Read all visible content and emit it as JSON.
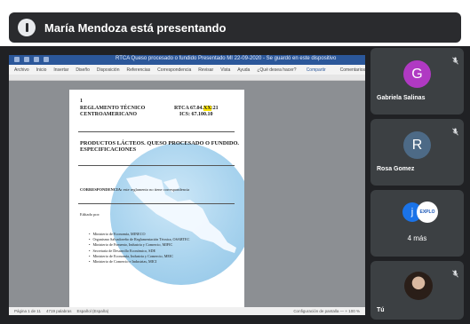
{
  "presenter_banner": {
    "text": "María Mendoza está presentando"
  },
  "shared_screen": {
    "window_title": "RTCA Queso procesado o fundido Presentado MI 22-09-2020 - Se guardó en este dispositivo",
    "menu": [
      "Archivo",
      "Inicio",
      "Insertar",
      "Diseño",
      "Disposición",
      "Referencias",
      "Correspondencia",
      "Revisar",
      "Vista",
      "Ayuda",
      "¿Qué desea hacer?"
    ],
    "menu_right": [
      "Compartir",
      "Comentarios"
    ],
    "document": {
      "heading_left_1": "REGLAMENTO TÉCNICO",
      "heading_left_2": "CENTROAMERICANO",
      "rtca_prefix": "RTCA 67.04.",
      "rtca_highlight": "XX",
      "rtca_suffix": ":21",
      "ics": "ICS: 67.100.10",
      "page_marker": "1",
      "product_title_1": "PRODUCTOS LÁCTEOS.  QUESO PROCESADO O FUNDIDO.",
      "product_title_2": "ESPECIFICACIONES",
      "correspondence_label": "CORRESPONDENCIA:",
      "correspondence_text": "este reglamento no tiene correspondencia",
      "edited_by": "Editado por:",
      "editors": [
        "Ministerio de Economía, MINECO",
        "Organismo Salvadoreño de Reglamentación Técnica, OSARTEC",
        "Ministerio de Fomento, Industria y Comercio, MIFIC",
        "Secretaría de Desarrollo Económico, SDE",
        "Ministerio de Economía, Industria y Comercio, MEIC",
        "Ministerio de Comercio e Industrias, MICI"
      ]
    },
    "status_left": [
      "Página 1 de 11",
      "4719 palabras",
      "Español (España)"
    ],
    "status_right": "Configuración de pantalla   —   +   100 %"
  },
  "participants": [
    {
      "initial": "G",
      "name": "Gabriela Salinas",
      "color": "#b039c3"
    },
    {
      "initial": "R",
      "name": "Rosa Gomez",
      "color": "#4d6a86"
    },
    {
      "initial": "j",
      "badge": "EXPLO",
      "more": "4 más",
      "color": "#1a73e8"
    },
    {
      "name": "Tú"
    }
  ]
}
